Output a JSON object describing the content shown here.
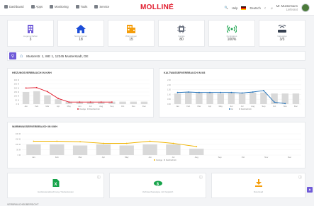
{
  "nav": [
    {
      "label": "Dashboard",
      "icon": "dashboard-icon"
    },
    {
      "label": "Apps",
      "icon": "apps-icon"
    },
    {
      "label": "Monitoring",
      "icon": "monitoring-icon"
    },
    {
      "label": "Tools",
      "icon": "tools-icon"
    },
    {
      "label": "Service",
      "icon": "service-icon"
    }
  ],
  "brand": "MOLLINÉ",
  "header_right": {
    "help": "Help",
    "language": "Deutsch",
    "user_name": "Mr. Mustermann",
    "user_sub": "Lieferant"
  },
  "cards": [
    {
      "label": "Liegenschaften",
      "value": "3",
      "icon": "building-icon",
      "color": "#6f5ad8"
    },
    {
      "label": "Nutzeinheiten",
      "value": "18",
      "icon": "house-icon",
      "color": "#1d4ed8"
    },
    {
      "label": "Wohnungen",
      "value": "15",
      "icon": "apartment-icon",
      "color": "#f59e0b"
    },
    {
      "label": "Geräte",
      "value": "80",
      "icon": "chip-icon",
      "color": "#6b7280"
    },
    {
      "label": "Funkstatus",
      "value": "100%",
      "icon": "radio-signal-icon",
      "color": "#16a34a"
    },
    {
      "label": "Gateways",
      "value": "3/3",
      "icon": "router-icon",
      "color": "#374151"
    }
  ],
  "address": "Musterstr. 1, WE 1, 12345 Musterstadt, DE",
  "months": [
    "Jan",
    "Feb",
    "Mar",
    "Apr",
    "May",
    "Jun",
    "Jul",
    "Aug",
    "Sep",
    "Oct",
    "Nov",
    "Dec"
  ],
  "warmwater_months": [
    "Jan",
    "Feb",
    "Mar",
    "Apr",
    "May",
    "Jun",
    "Jul",
    "Aug",
    "Sep",
    "Oct",
    "Nov",
    "Dec"
  ],
  "chart_data": [
    {
      "type": "bar",
      "title": "HEIZUNGSVERBRAUCH IN KWH",
      "categories": [
        "Jan",
        "Feb",
        "Mar",
        "Apr",
        "May",
        "Jun",
        "Jul",
        "Aug",
        "Sep",
        "Oct",
        "Nov",
        "Dec"
      ],
      "yticks": [
        "300 M",
        "250 M",
        "200 M",
        "150 M",
        "100 M",
        "50 M",
        "0 M"
      ],
      "ylim": [
        0,
        300
      ],
      "series": [
        {
          "name": "Overige",
          "kind": "line",
          "color": "#e11d2e",
          "values": [
            200,
            205,
            155,
            70,
            25,
            25,
            25,
            25,
            25,
            null,
            null,
            null
          ]
        },
        {
          "name": "Durchschnitt",
          "kind": "bar",
          "color": "#d9d9d9",
          "values": [
            150,
            160,
            110,
            60,
            30,
            30,
            30,
            30,
            30,
            30,
            30,
            30
          ]
        }
      ],
      "legend": "bottom"
    },
    {
      "type": "bar",
      "title": "KALTWASSERVERBRAUCH IN M3",
      "categories": [
        "Jan",
        "Feb",
        "Mar",
        "Apr",
        "May",
        "Jun",
        "Jul",
        "Aug",
        "Sep",
        "Oct",
        "Nov",
        "Dec"
      ],
      "yticks": [
        "2.50",
        "2.00",
        "1.50",
        "1.00",
        "0.50",
        "0.00"
      ],
      "ylim": [
        0,
        2.5
      ],
      "series": [
        {
          "name": "Ist",
          "kind": "line",
          "color": "#1d6fb8",
          "values": [
            1.2,
            1.25,
            1.2,
            1.2,
            1.2,
            1.2,
            1.15,
            1.25,
            1.4,
            0.2,
            0.05,
            null
          ]
        },
        {
          "name": "Durchschnitt",
          "kind": "bar",
          "color": "#d9d9d9",
          "values": [
            1.1,
            1.2,
            1.2,
            1.2,
            1.1,
            1.2,
            1.1,
            1.2,
            1.2,
            1.1,
            1.1,
            1.1
          ]
        }
      ],
      "legend": "bottom"
    },
    {
      "type": "bar",
      "title": "WARMWASSERVERBRAUCH IN KWH",
      "categories": [
        "Jan",
        "Feb",
        "Mar",
        "Apr",
        "May",
        "Jun",
        "Jul",
        "Aug",
        "Sep",
        "Oct",
        "Nov",
        "Dec"
      ],
      "yticks": [
        "200 M",
        "150 M",
        "100 M",
        "50 M",
        "0 M"
      ],
      "ylim": [
        0,
        200
      ],
      "series": [
        {
          "name": "Overige",
          "kind": "line",
          "color": "#f0b400",
          "values": [
            130,
            130,
            125,
            110,
            110,
            130,
            110,
            80,
            null,
            null,
            null,
            null
          ]
        },
        {
          "name": "Durchschnitt",
          "kind": "bar",
          "color": "#d9d9d9",
          "values": [
            100,
            100,
            90,
            100,
            90,
            100,
            100,
            60,
            null,
            null,
            null,
            null
          ]
        }
      ],
      "legend": "bottom"
    }
  ],
  "actions": [
    {
      "label": "Heizkostenabrechnung / Nebenkosten",
      "icon": "excel-document-icon",
      "color": "#16a34a"
    },
    {
      "label": "Verbrauchsanalyse mit Vergleich",
      "icon": "money-icon",
      "color": "#16a34a"
    },
    {
      "label": "Download",
      "icon": "download-icon",
      "color": "#f59e0b"
    }
  ],
  "footer": "VERBRAUCHSÜBERSICHT"
}
